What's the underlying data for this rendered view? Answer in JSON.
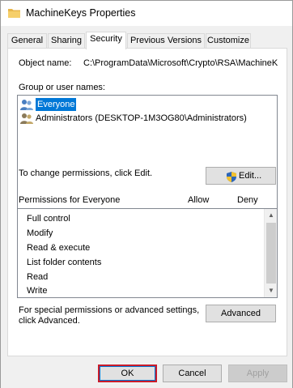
{
  "window": {
    "title": "MachineKeys Properties"
  },
  "tabs": [
    {
      "label": "General"
    },
    {
      "label": "Sharing"
    },
    {
      "label": "Security"
    },
    {
      "label": "Previous Versions"
    },
    {
      "label": "Customize"
    }
  ],
  "security": {
    "object_name_label": "Object name:",
    "object_name_value": "C:\\ProgramData\\Microsoft\\Crypto\\RSA\\MachineK",
    "groups_label": "Group or user names:",
    "groups": [
      {
        "name": "Everyone",
        "selected": true,
        "icon": "users-icon"
      },
      {
        "name": "Administrators (DESKTOP-1M3OG80\\Administrators)",
        "selected": false,
        "icon": "admins-icon"
      }
    ],
    "change_permissions_text": "To change permissions, click Edit.",
    "edit_button": "Edit...",
    "permissions_for_label": "Permissions for Everyone",
    "allow_label": "Allow",
    "deny_label": "Deny",
    "permissions": [
      {
        "name": "Full control"
      },
      {
        "name": "Modify"
      },
      {
        "name": "Read & execute"
      },
      {
        "name": "List folder contents"
      },
      {
        "name": "Read"
      },
      {
        "name": "Write"
      }
    ],
    "advanced_text_line1": "For special permissions or advanced settings,",
    "advanced_text_line2": "click Advanced.",
    "advanced_button": "Advanced"
  },
  "footer": {
    "ok_button": "OK",
    "cancel_button": "Cancel",
    "apply_button": "Apply"
  },
  "colors": {
    "selection": "#0078d7",
    "ok_highlight": "#c91b2a",
    "folder": "#e8b64a"
  }
}
